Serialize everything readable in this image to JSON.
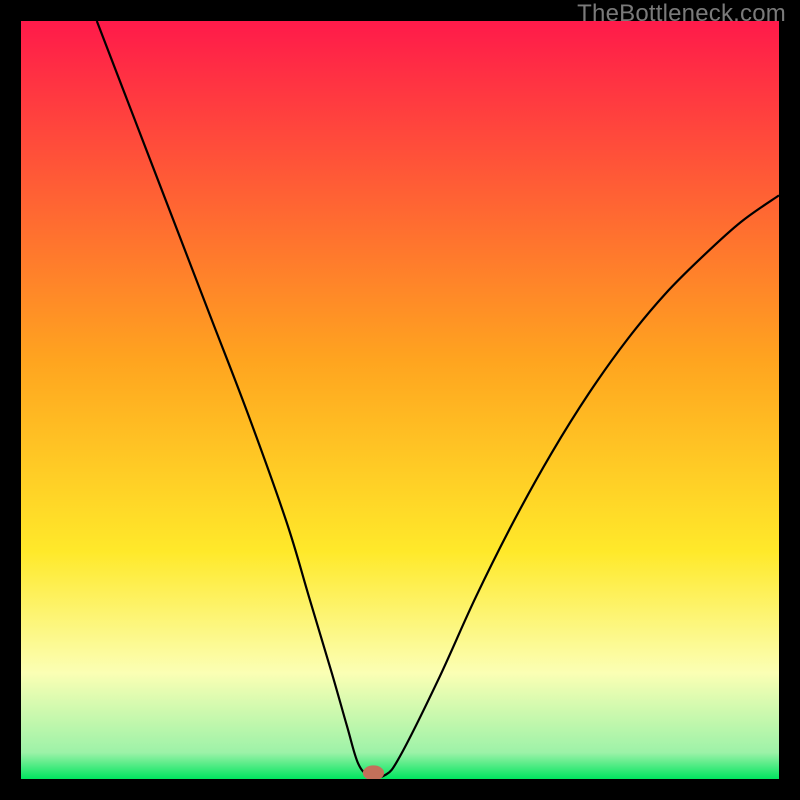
{
  "watermark": {
    "text": "TheBottleneck.com"
  },
  "chart_data": {
    "type": "line",
    "title": "",
    "xlabel": "",
    "ylabel": "",
    "xlim": [
      0,
      100
    ],
    "ylim": [
      0,
      100
    ],
    "grid": false,
    "background_gradient": {
      "stops": [
        {
          "offset": 0.0,
          "color": "#ff1a4a"
        },
        {
          "offset": 0.45,
          "color": "#ffa51f"
        },
        {
          "offset": 0.7,
          "color": "#ffe92a"
        },
        {
          "offset": 0.86,
          "color": "#fbffb4"
        },
        {
          "offset": 0.965,
          "color": "#9df2a8"
        },
        {
          "offset": 1.0,
          "color": "#00e55f"
        }
      ]
    },
    "series": [
      {
        "name": "bottleneck-curve",
        "type": "line",
        "color": "#000000",
        "x": [
          10,
          15,
          20,
          25,
          30,
          35,
          38,
          41,
          43,
          44.5,
          46,
          48,
          50,
          55,
          60,
          65,
          70,
          75,
          80,
          85,
          90,
          95,
          100
        ],
        "y": [
          100,
          87,
          74,
          61,
          48,
          34,
          24,
          14,
          7,
          2,
          0.5,
          0.5,
          3,
          13,
          24,
          34,
          43,
          51,
          58,
          64,
          69,
          73.5,
          77
        ]
      }
    ],
    "marker": {
      "name": "optimal-point",
      "x": 46.5,
      "y": 0.8,
      "rx": 1.4,
      "ry": 1.0,
      "color": "#c4705a"
    }
  }
}
